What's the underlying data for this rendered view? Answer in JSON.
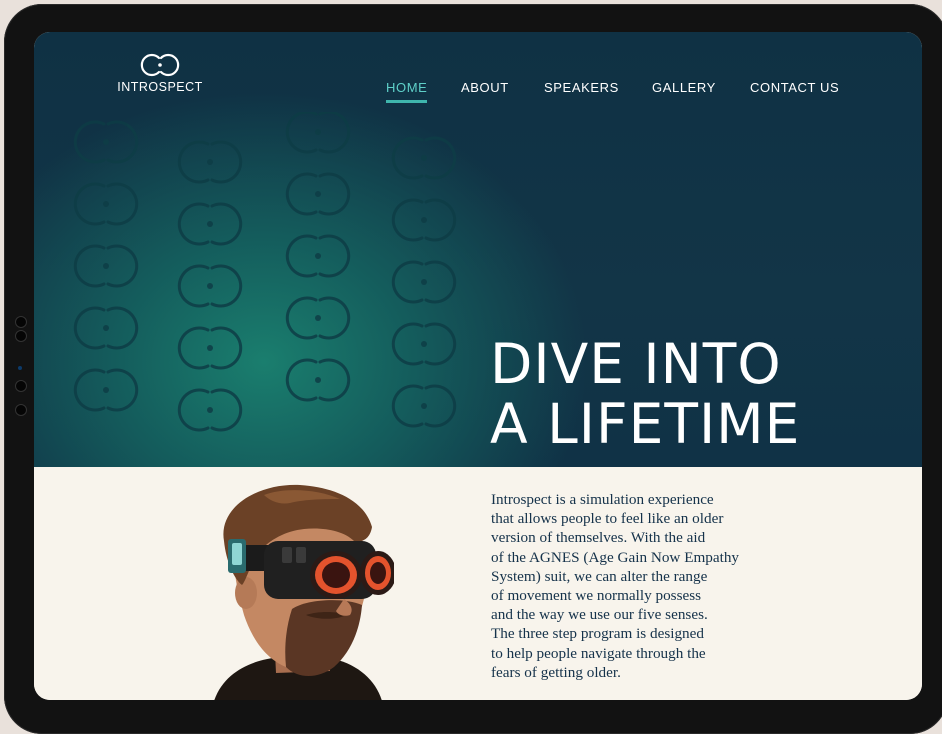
{
  "brand": {
    "name": "INTROSPECT",
    "logo_icon": "interlocking-rings-logo"
  },
  "nav": {
    "items": [
      {
        "label": "HOME",
        "active": true
      },
      {
        "label": "ABOUT",
        "active": false
      },
      {
        "label": "SPEAKERS",
        "active": false
      },
      {
        "label": "GALLERY",
        "active": false
      },
      {
        "label": "CONTACT US",
        "active": false
      }
    ]
  },
  "hero": {
    "headline_line1": "DIVE INTO",
    "headline_line2": "A LIFETIME"
  },
  "about": {
    "image_subject": "bearded man wearing VR goggles",
    "lines": [
      "Introspect is a simulation experience",
      "that allows people to feel like an older",
      "version of themselves. With the aid",
      "of the AGNES (Age Gain Now Empathy",
      "System) suit, we can alter the range",
      "of movement we normally possess",
      "and the way we use our five senses.",
      "The three step program is designed",
      "to help people navigate through the",
      "fears of getting older."
    ]
  },
  "colors": {
    "hero_dark": "#0f3144",
    "hero_teal": "#1a7e6e",
    "accent": "#5fd0c9",
    "body_text": "#15324a",
    "content_bg": "#f8f4ec"
  }
}
